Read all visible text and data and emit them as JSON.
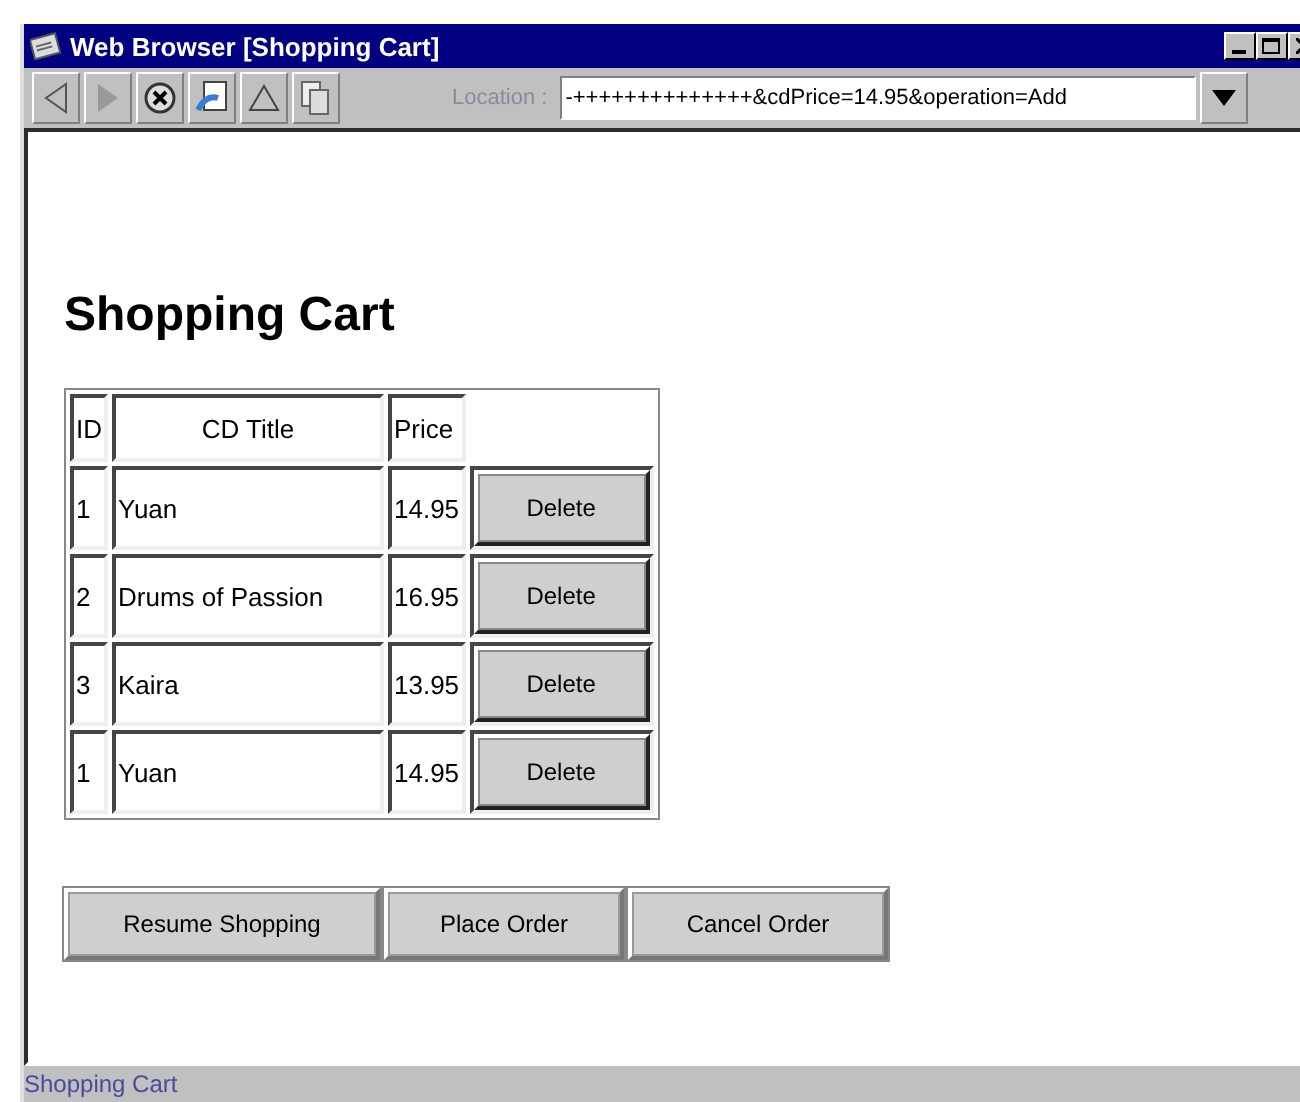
{
  "window": {
    "title": "Web Browser [Shopping Cart]"
  },
  "toolbar": {
    "location_label": "Location :",
    "location_value": "-++++++++++++++&cdPrice=14.95&operation=Add"
  },
  "page": {
    "heading": "Shopping Cart",
    "table": {
      "columns": [
        "ID",
        "CD Title",
        "Price"
      ],
      "rows": [
        {
          "id": "1",
          "title": "Yuan",
          "price": "14.95",
          "action": "Delete"
        },
        {
          "id": "2",
          "title": "Drums of Passion",
          "price": "16.95",
          "action": "Delete"
        },
        {
          "id": "3",
          "title": "Kaira",
          "price": "13.95",
          "action": "Delete"
        },
        {
          "id": "1",
          "title": "Yuan",
          "price": "14.95",
          "action": "Delete"
        }
      ]
    },
    "buttons": [
      "Resume Shopping",
      "Place Order",
      "Cancel Order"
    ]
  },
  "status_bar": "Shopping Cart"
}
